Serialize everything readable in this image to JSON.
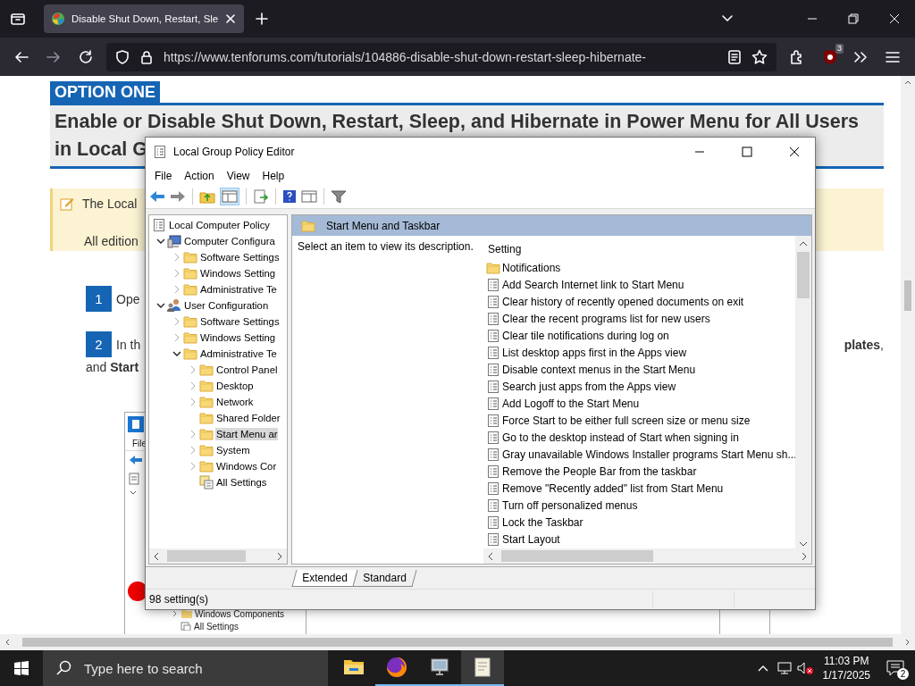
{
  "browser": {
    "tab": {
      "title": "Disable Shut Down, Restart, Sle",
      "selected": true
    },
    "url": "https://www.tenforums.com/tutorials/104886-disable-shut-down-restart-sleep-hibernate-",
    "extension_badge": "3"
  },
  "page": {
    "option_label": "OPTION ONE",
    "heading_lines": [
      "Enable or Disable Shut Down, Restart, Sleep, and Hibernate in Power Menu for All Users",
      "in Local G"
    ],
    "note_lines": [
      "The Local",
      "All edition"
    ],
    "steps": [
      {
        "number": "1",
        "text": "Ope"
      },
      {
        "number": "2",
        "text": "In th",
        "text_right": "**plates**,",
        "continuation": "and **Start**"
      }
    ],
    "embedded_screenshot": {
      "menu": "File",
      "tree": [
        "Windows Components",
        "All Settings"
      ]
    }
  },
  "gpe": {
    "title": "Local Group Policy Editor",
    "menu": [
      "File",
      "Action",
      "View",
      "Help"
    ],
    "tree": [
      {
        "label": "Local Computer Policy",
        "kind": "policy",
        "expandable": false,
        "selected": false,
        "children": [
          {
            "label": "Computer Configura",
            "kind": "computer",
            "expandable": true,
            "expanded": true,
            "selected": false,
            "children": [
              {
                "label": "Software Settings",
                "kind": "folder",
                "expandable": true,
                "expanded": false,
                "selected": false
              },
              {
                "label": "Windows Setting",
                "kind": "folder",
                "expandable": true,
                "expanded": false,
                "selected": false
              },
              {
                "label": "Administrative Te",
                "kind": "folder",
                "expandable": true,
                "expanded": false,
                "selected": false
              }
            ]
          },
          {
            "label": "User Configuration",
            "kind": "user",
            "expandable": true,
            "expanded": true,
            "selected": false,
            "children": [
              {
                "label": "Software Settings",
                "kind": "folder",
                "expandable": true,
                "expanded": false,
                "selected": false
              },
              {
                "label": "Windows Setting",
                "kind": "folder",
                "expandable": true,
                "expanded": false,
                "selected": false
              },
              {
                "label": "Administrative Te",
                "kind": "folder",
                "expandable": true,
                "expanded": true,
                "selected": false,
                "children": [
                  {
                    "label": "Control Panel",
                    "kind": "folder",
                    "expandable": true,
                    "expanded": false,
                    "selected": false
                  },
                  {
                    "label": "Desktop",
                    "kind": "folder",
                    "expandable": true,
                    "expanded": false,
                    "selected": false
                  },
                  {
                    "label": "Network",
                    "kind": "folder",
                    "expandable": true,
                    "expanded": false,
                    "selected": false
                  },
                  {
                    "label": "Shared Folder",
                    "kind": "folder",
                    "expandable": false,
                    "selected": false
                  },
                  {
                    "label": "Start Menu ar",
                    "kind": "folder",
                    "expandable": true,
                    "expanded": false,
                    "selected": true
                  },
                  {
                    "label": "System",
                    "kind": "folder",
                    "expandable": true,
                    "expanded": false,
                    "selected": false
                  },
                  {
                    "label": "Windows Cor",
                    "kind": "folder",
                    "expandable": true,
                    "expanded": false,
                    "selected": false
                  },
                  {
                    "label": "All Settings",
                    "kind": "settings",
                    "expandable": false,
                    "selected": false
                  }
                ]
              }
            ]
          }
        ]
      }
    ],
    "header": "Start Menu and Taskbar",
    "description": "Select an item to view its description.",
    "column": "Setting",
    "settings": [
      {
        "label": "Notifications",
        "kind": "folder"
      },
      {
        "label": "Add Search Internet link to Start Menu",
        "kind": "policy"
      },
      {
        "label": "Clear history of recently opened documents on exit",
        "kind": "policy"
      },
      {
        "label": "Clear the recent programs list for new users",
        "kind": "policy"
      },
      {
        "label": "Clear tile notifications during log on",
        "kind": "policy"
      },
      {
        "label": "List desktop apps first in the Apps view",
        "kind": "policy"
      },
      {
        "label": "Disable context menus in the Start Menu",
        "kind": "policy"
      },
      {
        "label": "Search just apps from the Apps view",
        "kind": "policy"
      },
      {
        "label": "Add Logoff to the Start Menu",
        "kind": "policy"
      },
      {
        "label": "Force Start to be either full screen size or menu size",
        "kind": "policy"
      },
      {
        "label": "Go to the desktop instead of Start when signing in",
        "kind": "policy"
      },
      {
        "label": "Gray unavailable Windows Installer programs Start Menu sh...",
        "kind": "policy"
      },
      {
        "label": "Remove the People Bar from the taskbar",
        "kind": "policy"
      },
      {
        "label": "Remove \"Recently added\" list from Start Menu",
        "kind": "policy"
      },
      {
        "label": "Turn off personalized menus",
        "kind": "policy"
      },
      {
        "label": "Lock the Taskbar",
        "kind": "policy"
      },
      {
        "label": "Start Layout",
        "kind": "policy"
      }
    ],
    "tabs": [
      {
        "label": "Extended",
        "selected": true
      },
      {
        "label": "Standard",
        "selected": false
      }
    ],
    "status": "98 setting(s)"
  },
  "taskbar": {
    "search_placeholder": "Type here to search",
    "apps": [
      {
        "kind": "explorer",
        "running": false,
        "selected": false
      },
      {
        "kind": "firefox",
        "running": true,
        "selected": false
      },
      {
        "kind": "mmc",
        "running": true,
        "selected": false
      },
      {
        "kind": "notepad",
        "running": true,
        "selected": true
      }
    ],
    "time": "11:03 PM",
    "date": "1/17/2025",
    "notification_count": "2"
  }
}
